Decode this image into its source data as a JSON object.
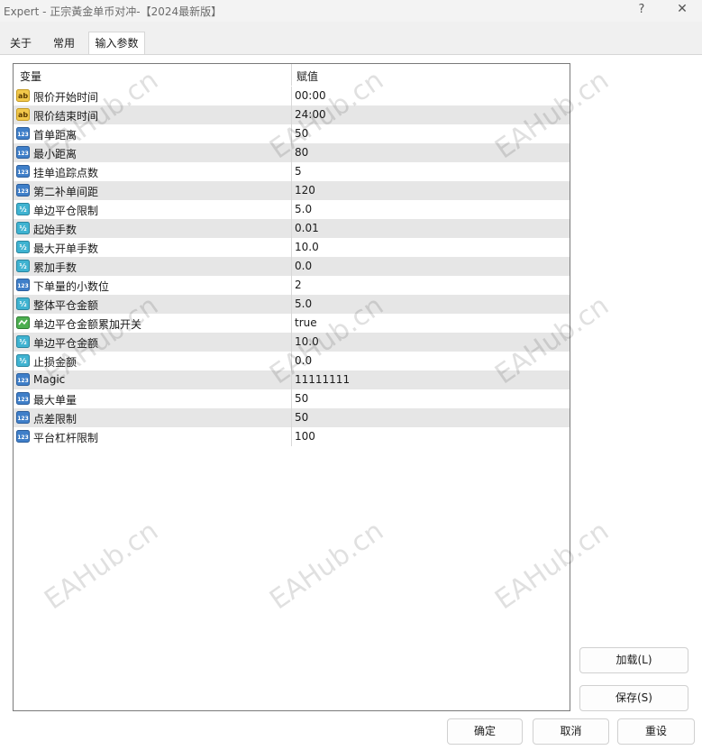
{
  "window": {
    "title": "Expert - 正宗黃金单币对冲-【2024最新版】",
    "help": "?",
    "close": "✕"
  },
  "tabs": [
    {
      "label": "关于"
    },
    {
      "label": "常用"
    },
    {
      "label": "输入参数",
      "active": true
    }
  ],
  "grid": {
    "headers": {
      "variable": "变量",
      "value": "赋值"
    },
    "rows": [
      {
        "name": "限价开始时间",
        "value": "00:00",
        "type": "string",
        "icon": "ab"
      },
      {
        "name": "限价结束时间",
        "value": "24:00",
        "type": "string",
        "icon": "ab"
      },
      {
        "name": "首单距离",
        "value": "50",
        "type": "int",
        "icon": "123"
      },
      {
        "name": "最小距离",
        "value": "80",
        "type": "int",
        "icon": "123"
      },
      {
        "name": "挂单追踪点数",
        "value": "5",
        "type": "int",
        "icon": "123"
      },
      {
        "name": "第二补单间距",
        "value": "120",
        "type": "int",
        "icon": "123"
      },
      {
        "name": "单边平仓限制",
        "value": "5.0",
        "type": "double",
        "icon": "½"
      },
      {
        "name": "起始手数",
        "value": "0.01",
        "type": "double",
        "icon": "½"
      },
      {
        "name": "最大开单手数",
        "value": "10.0",
        "type": "double",
        "icon": "½"
      },
      {
        "name": "累加手数",
        "value": "0.0",
        "type": "double",
        "icon": "½"
      },
      {
        "name": "下单量的小数位",
        "value": "2",
        "type": "int",
        "icon": "123"
      },
      {
        "name": "整体平仓金额",
        "value": "5.0",
        "type": "double",
        "icon": "½"
      },
      {
        "name": "单边平仓金额累加开关",
        "value": "true",
        "type": "bool",
        "icon": "bool"
      },
      {
        "name": "单边平仓金额",
        "value": "10.0",
        "type": "double",
        "icon": "½"
      },
      {
        "name": "止损金额",
        "value": "0.0",
        "type": "double",
        "icon": "½"
      },
      {
        "name": "Magic",
        "value": "11111111",
        "type": "int",
        "icon": "123"
      },
      {
        "name": "最大单量",
        "value": "50",
        "type": "int",
        "icon": "123"
      },
      {
        "name": "点差限制",
        "value": "50",
        "type": "int",
        "icon": "123"
      },
      {
        "name": "平台杠杆限制",
        "value": "100",
        "type": "int",
        "icon": "123"
      }
    ]
  },
  "buttons": {
    "load": "加载(L)",
    "save": "保存(S)",
    "ok": "确定",
    "cancel": "取消",
    "reset": "重设"
  },
  "watermark": "EAHub.cn",
  "colors": {
    "string_icon": "#f2c84b",
    "int_icon": "#3f7fc9",
    "double_icon": "#3fb3d1",
    "bool_icon": "#4caf50"
  }
}
